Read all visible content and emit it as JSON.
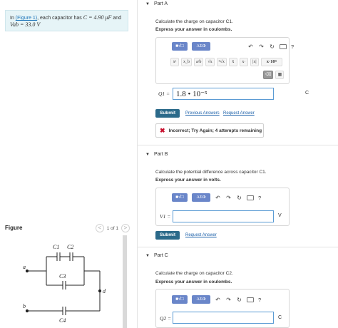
{
  "problem": {
    "prefix": "In ",
    "figure_link": "(Figure 1)",
    "text_mid": ", each capacitor has ",
    "c_value": "C = 4.90 μF",
    "and": " and",
    "v_value": "Vab = 33.0 V"
  },
  "figure": {
    "title": "Figure",
    "prev": "<",
    "count": "1 of 1",
    "next": ">",
    "labels": {
      "c1": "C1",
      "c2": "C2",
      "c3": "C3",
      "c4": "C4",
      "a": "a",
      "b": "b",
      "d": "d"
    }
  },
  "partA": {
    "header": "Part A",
    "question": "Calculate the charge on capacitor C1.",
    "instruction": "Express your answer in coulombs.",
    "toolbar": {
      "templates": "■√□",
      "greek": "ΑΣΦ",
      "help": "?"
    },
    "symbols": [
      "xᵃ",
      "x_b",
      "a/b",
      "√x",
      "ⁿ√x",
      "x̄",
      "x·",
      "|x|",
      "x·10ⁿ"
    ],
    "input_label": "Q1 =",
    "answer": "1.8 • 10⁻⁵",
    "unit": "C",
    "submit": "Submit",
    "previous_answers": "Previous Answers",
    "request_answer": "Request Answer",
    "feedback": "Incorrect; Try Again; 4 attempts remaining"
  },
  "partB": {
    "header": "Part B",
    "question": "Calculate the potential difference across capacitor C1.",
    "instruction": "Express your answer in volts.",
    "toolbar": {
      "templates": "■√□",
      "greek": "ΑΣΦ",
      "help": "?"
    },
    "input_label": "V1 =",
    "answer": "",
    "unit": "V",
    "submit": "Submit",
    "request_answer": "Request Answer"
  },
  "partC": {
    "header": "Part C",
    "question": "Calculate the charge on capacitor C2.",
    "instruction": "Express your answer in coulombs.",
    "toolbar": {
      "templates": "■√□",
      "greek": "ΑΣΦ",
      "help": "?"
    },
    "input_label": "Q2 =",
    "answer": "",
    "unit": "C"
  },
  "colors": {
    "accent": "#2b6a8a",
    "chip": "#6a86c9",
    "error": "#c8102e",
    "problem_bg": "#e6f4f7",
    "input_border": "#5a9bd4"
  }
}
